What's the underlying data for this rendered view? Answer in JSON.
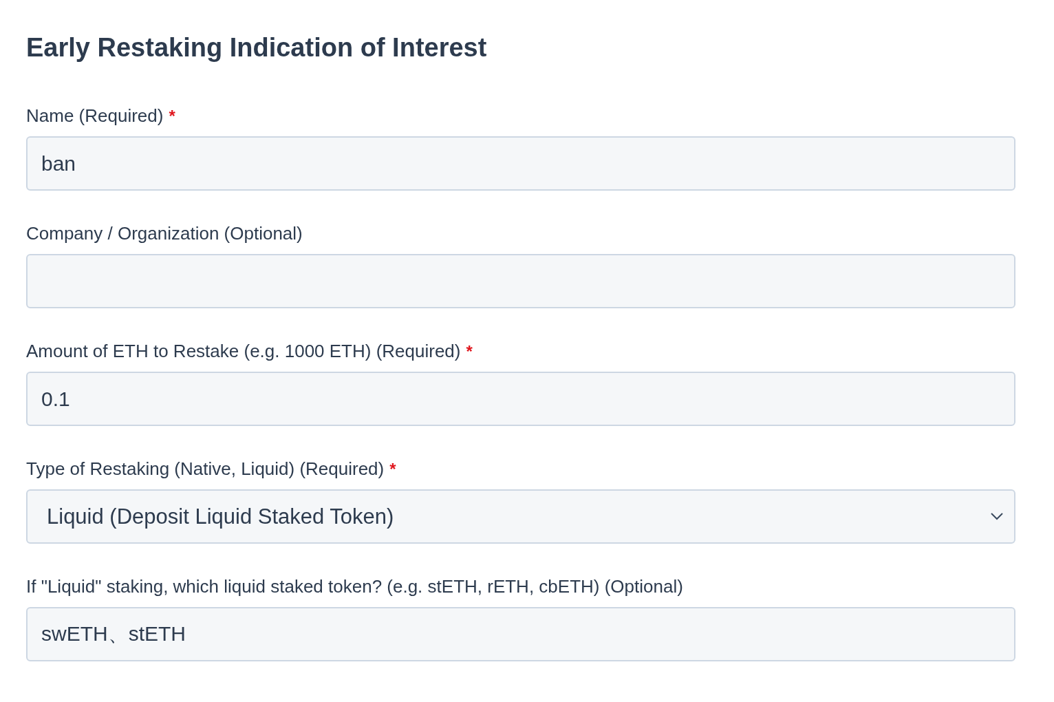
{
  "title": "Early Restaking Indication of Interest",
  "fields": [
    {
      "kind": "text",
      "label": "Name (Required)",
      "required_mark": "*",
      "value": "ban"
    },
    {
      "kind": "text",
      "label": "Company / Organization (Optional)"
    },
    {
      "kind": "text",
      "label": "Amount of ETH to Restake (e.g. 1000 ETH) (Required)",
      "required_mark": "*",
      "value": "0.1"
    },
    {
      "kind": "select",
      "label": "Type of Restaking (Native, Liquid) (Required)",
      "required_mark": "*",
      "value": "Liquid (Deposit Liquid Staked Token)"
    },
    {
      "kind": "text",
      "label": "If \"Liquid\" staking, which liquid staked token? (e.g. stETH, rETH, cbETH) (Optional)",
      "value": "swETH、stETH"
    }
  ]
}
